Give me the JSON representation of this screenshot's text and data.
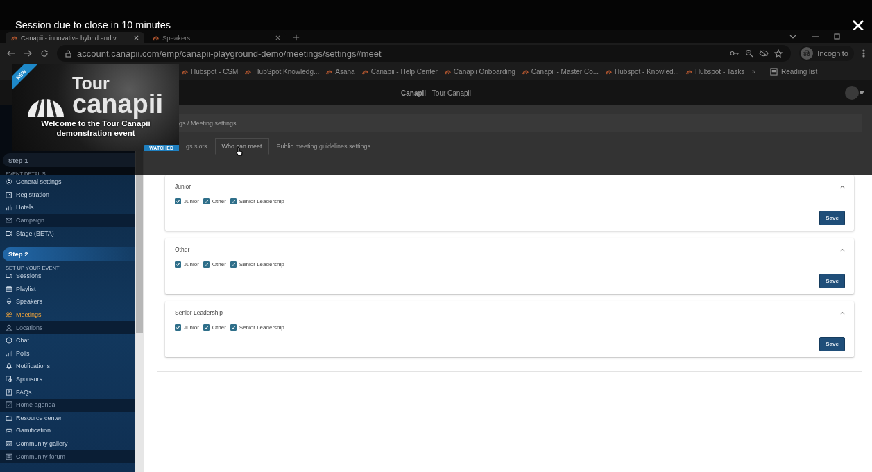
{
  "session_banner": {
    "text": "Session due to close in 10 minutes"
  },
  "browser": {
    "tabs": [
      {
        "label": "Canapii - innovative hybrid and v",
        "selected": true
      },
      {
        "label": "Speakers",
        "selected": false
      }
    ],
    "address": "account.canapii.com/emp/canapii-playground-demo/meetings/settings#meet",
    "profile": "Incognito",
    "bookmarks": [
      "Hubspot - CSM",
      "HubSpot Knowledg...",
      "Asana",
      "Canapii - Help Center",
      "Canapii Onboarding",
      "Canapii - Master Co...",
      "Hubspot - Knowled...",
      "Hubspot - Tasks"
    ],
    "more_bookmarks": "»",
    "reading_list": "Reading list"
  },
  "app_header": {
    "title": "**Canapii** - Tour Canapii"
  },
  "tour_card": {
    "ribbon": "NEW",
    "logo_top": "Tour",
    "logo_word": "canapii",
    "caption": "Welcome to the Tour Canapii demonstration event",
    "badge": "WATCHED"
  },
  "sidebar": {
    "sections": [
      {
        "step": "Step 1",
        "selected": false,
        "heading": "EVENT DETAILS",
        "items": [
          {
            "label": "General settings",
            "selected": false,
            "disabled": false
          },
          {
            "label": "Registration",
            "selected": false,
            "disabled": false
          },
          {
            "label": "Hotels",
            "selected": false,
            "disabled": false
          },
          {
            "label": "Campaign",
            "selected": false,
            "disabled": true
          },
          {
            "label": "Stage (BETA)",
            "selected": false,
            "disabled": false
          }
        ]
      },
      {
        "step": "Step 2",
        "selected": true,
        "heading": "SET UP YOUR EVENT",
        "items": [
          {
            "label": "Sessions",
            "selected": false,
            "disabled": false
          },
          {
            "label": "Playlist",
            "selected": false,
            "disabled": false
          },
          {
            "label": "Speakers",
            "selected": false,
            "disabled": false
          },
          {
            "label": "Meetings",
            "selected": true,
            "disabled": false
          },
          {
            "label": "Locations",
            "selected": false,
            "disabled": true
          },
          {
            "label": "Chat",
            "selected": false,
            "disabled": false
          },
          {
            "label": "Polls",
            "selected": false,
            "disabled": false
          },
          {
            "label": "Notifications",
            "selected": false,
            "disabled": false
          },
          {
            "label": "Sponsors",
            "selected": false,
            "disabled": false
          },
          {
            "label": "FAQs",
            "selected": false,
            "disabled": false
          },
          {
            "label": "Home agenda",
            "selected": false,
            "disabled": true
          },
          {
            "label": "Resource center",
            "selected": false,
            "disabled": false
          },
          {
            "label": "Gamification",
            "selected": false,
            "disabled": false
          },
          {
            "label": "Community gallery",
            "selected": false,
            "disabled": false
          },
          {
            "label": "Community forum",
            "selected": false,
            "disabled": true
          }
        ]
      }
    ]
  },
  "breadcrumb": "gs / Meeting settings",
  "tabs": [
    {
      "label": "gs slots",
      "selected": false
    },
    {
      "label": "Who can meet",
      "selected": true
    },
    {
      "label": "Public meeting guidelines settings",
      "selected": false
    }
  ],
  "groups": [
    {
      "title": "Junior",
      "expanded": true,
      "options": [
        {
          "label": "Junior",
          "checked": true
        },
        {
          "label": "Other",
          "checked": true
        },
        {
          "label": "Senior Leadership",
          "checked": true
        }
      ],
      "button": "Save"
    },
    {
      "title": "Other",
      "expanded": true,
      "options": [
        {
          "label": "Junior",
          "checked": true
        },
        {
          "label": "Other",
          "checked": true
        },
        {
          "label": "Senior Leadership",
          "checked": true
        }
      ],
      "button": "Save"
    },
    {
      "title": "Senior Leadership",
      "expanded": true,
      "options": [
        {
          "label": "Junior",
          "checked": true
        },
        {
          "label": "Other",
          "checked": true
        },
        {
          "label": "Senior Leadership",
          "checked": true
        }
      ],
      "button": "Save"
    }
  ]
}
